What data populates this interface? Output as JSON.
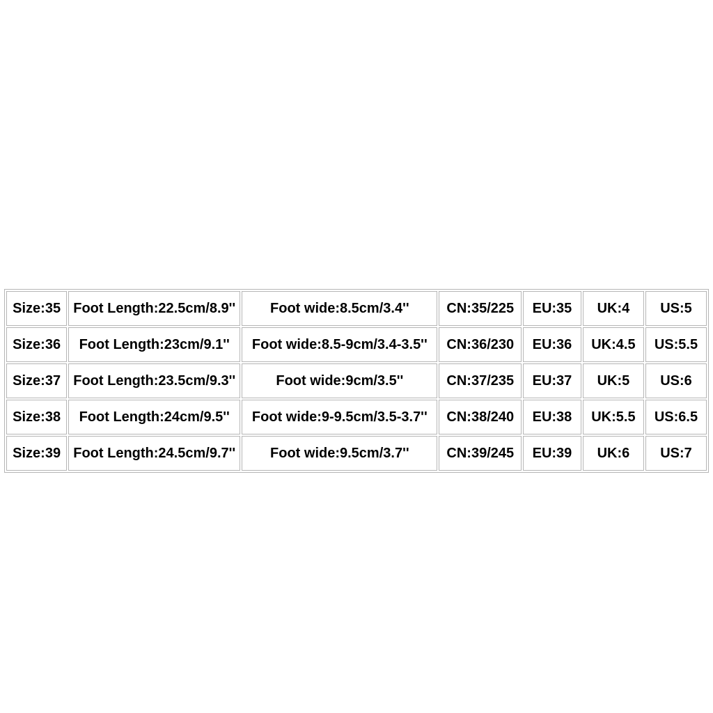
{
  "table": {
    "rows": [
      {
        "size": "Size:35",
        "foot_length": "Foot Length:22.5cm/8.9''",
        "foot_wide": "Foot wide:8.5cm/3.4''",
        "cn": "CN:35/225",
        "eu": "EU:35",
        "uk": "UK:4",
        "us": "US:5"
      },
      {
        "size": "Size:36",
        "foot_length": "Foot Length:23cm/9.1''",
        "foot_wide": "Foot wide:8.5-9cm/3.4-3.5''",
        "cn": "CN:36/230",
        "eu": "EU:36",
        "uk": "UK:4.5",
        "us": "US:5.5"
      },
      {
        "size": "Size:37",
        "foot_length": "Foot Length:23.5cm/9.3''",
        "foot_wide": "Foot wide:9cm/3.5''",
        "cn": "CN:37/235",
        "eu": "EU:37",
        "uk": "UK:5",
        "us": "US:6"
      },
      {
        "size": "Size:38",
        "foot_length": "Foot Length:24cm/9.5''",
        "foot_wide": "Foot wide:9-9.5cm/3.5-3.7''",
        "cn": "CN:38/240",
        "eu": "EU:38",
        "uk": "UK:5.5",
        "us": "US:6.5"
      },
      {
        "size": "Size:39",
        "foot_length": "Foot Length:24.5cm/9.7''",
        "foot_wide": "Foot wide:9.5cm/3.7''",
        "cn": "CN:39/245",
        "eu": "EU:39",
        "uk": "UK:6",
        "us": "US:7"
      }
    ]
  }
}
